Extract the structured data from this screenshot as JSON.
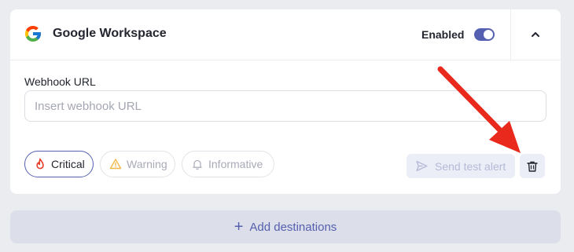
{
  "integration": {
    "name": "Google Workspace",
    "status_label": "Enabled",
    "enabled": true
  },
  "webhook": {
    "label": "Webhook URL",
    "value": "",
    "placeholder": "Insert webhook URL"
  },
  "severity_chips": [
    {
      "label": "Critical",
      "selected": true
    },
    {
      "label": "Warning",
      "selected": false
    },
    {
      "label": "Informative",
      "selected": false
    }
  ],
  "actions": {
    "send_test_label": "Send test alert"
  },
  "add_destinations_label": "Add destinations",
  "colors": {
    "accent": "#5560b0",
    "critical_icon": "#e8402d",
    "warning_icon": "#f0b84a",
    "annotation_arrow": "#e8291c"
  },
  "icons": [
    "google-logo",
    "chevron-up-icon",
    "flame-icon",
    "warning-triangle-icon",
    "bell-icon",
    "send-icon",
    "trash-icon",
    "plus-icon"
  ]
}
